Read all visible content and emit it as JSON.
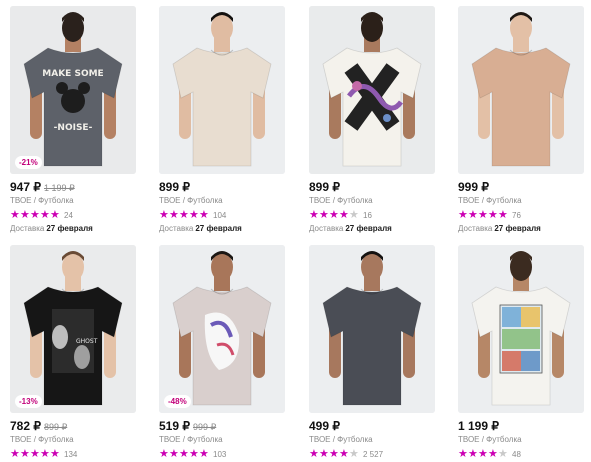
{
  "products": [
    {
      "price": "947 ₽",
      "old_price": "1 199 ₽",
      "discount": "-21%",
      "brand": "ТВОЕ / Футболка",
      "stars": 5,
      "reviews": "24",
      "delivery_label": "Доставка",
      "delivery_date": "27 февраля",
      "shirt_color": "#5d6169",
      "bg": "#e9eaeb",
      "skin": "#b48163",
      "hair": "#2a211c",
      "view": "back",
      "print": "mickey"
    },
    {
      "price": "899 ₽",
      "old_price": "",
      "discount": "",
      "brand": "ТВОЕ / Футболка",
      "stars": 5,
      "reviews": "104",
      "delivery_label": "Доставка",
      "delivery_date": "27 февраля",
      "shirt_color": "#e8ddd0",
      "bg": "#eceef0",
      "skin": "#e0bca2",
      "hair": "#14110f",
      "view": "front",
      "print": "none"
    },
    {
      "price": "899 ₽",
      "old_price": "",
      "discount": "",
      "brand": "ТВОЕ / Футболка",
      "stars": 4,
      "reviews": "16",
      "delivery_label": "Доставка",
      "delivery_date": "27 февраля",
      "shirt_color": "#f4f2ec",
      "bg": "#e9ebec",
      "skin": "#a97a5e",
      "hair": "#2b2019",
      "view": "back",
      "print": "dragon"
    },
    {
      "price": "999 ₽",
      "old_price": "",
      "discount": "",
      "brand": "ТВОЕ / Футболка",
      "stars": 5,
      "reviews": "76",
      "delivery_label": "Доставка",
      "delivery_date": "27 февраля",
      "shirt_color": "#d8ae93",
      "bg": "#eceef0",
      "skin": "#e3c0a6",
      "hair": "#1e1814",
      "view": "front",
      "print": "none"
    },
    {
      "price": "782 ₽",
      "old_price": "899 ₽",
      "discount": "-13%",
      "brand": "ТВОЕ / Футболка",
      "stars": 5,
      "reviews": "134",
      "delivery_label": "",
      "delivery_date": "",
      "shirt_color": "#161616",
      "bg": "#eaebec",
      "skin": "#e4c2a8",
      "hair": "#6a4b35",
      "view": "front",
      "print": "ghost"
    },
    {
      "price": "519 ₽",
      "old_price": "999 ₽",
      "discount": "-48%",
      "brand": "ТВОЕ / Футболка",
      "stars": 5,
      "reviews": "103",
      "delivery_label": "",
      "delivery_date": "",
      "shirt_color": "#d9cfcd",
      "bg": "#eceef0",
      "skin": "#a8765a",
      "hair": "#1c1714",
      "view": "front",
      "print": "anime"
    },
    {
      "price": "499 ₽",
      "old_price": "",
      "discount": "",
      "brand": "ТВОЕ / Футболка",
      "stars": 4,
      "reviews": "2 527",
      "delivery_label": "",
      "delivery_date": "",
      "shirt_color": "#4a4d55",
      "bg": "#eceef0",
      "skin": "#a7785e",
      "hair": "#151211",
      "view": "front",
      "print": "none"
    },
    {
      "price": "1 199 ₽",
      "old_price": "",
      "discount": "",
      "brand": "ТВОЕ / Футболка",
      "stars": 4,
      "reviews": "48",
      "delivery_label": "",
      "delivery_date": "",
      "shirt_color": "#f4f3ef",
      "bg": "#eceef0",
      "skin": "#b68767",
      "hair": "#3b2b20",
      "view": "back",
      "print": "comic"
    }
  ]
}
